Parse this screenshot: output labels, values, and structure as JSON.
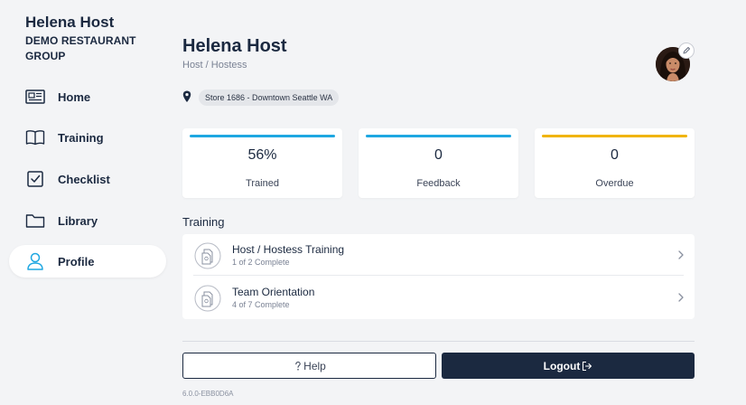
{
  "sidebar": {
    "user_name": "Helena Host",
    "org_name": "DEMO RESTAURANT GROUP",
    "items": [
      {
        "label": "Home",
        "icon": "newspaper-icon"
      },
      {
        "label": "Training",
        "icon": "book-icon"
      },
      {
        "label": "Checklist",
        "icon": "checkbox-icon"
      },
      {
        "label": "Library",
        "icon": "folder-icon"
      },
      {
        "label": "Profile",
        "icon": "user-icon",
        "active": true
      }
    ]
  },
  "profile": {
    "name": "Helena Host",
    "role": "Host / Hostess",
    "location": "Store 1686 - Downtown Seattle WA"
  },
  "stats": [
    {
      "value": "56%",
      "label": "Trained",
      "color": "#1ea7e1"
    },
    {
      "value": "0",
      "label": "Feedback",
      "color": "#1ea7e1"
    },
    {
      "value": "0",
      "label": "Overdue",
      "color": "#f0b400"
    }
  ],
  "training": {
    "title": "Training",
    "items": [
      {
        "title": "Host / Hostess Training",
        "progress": "1 of 2 Complete"
      },
      {
        "title": "Team Orientation",
        "progress": "4 of 7 Complete"
      }
    ]
  },
  "actions": {
    "help_label": "Help",
    "logout_label": "Logout"
  },
  "version": "6.0.0-EBB0D6A",
  "colors": {
    "primary": "#1b2940",
    "accent_blue": "#1ea7e1",
    "accent_yellow": "#f0b400",
    "background": "#f3f4f6"
  }
}
